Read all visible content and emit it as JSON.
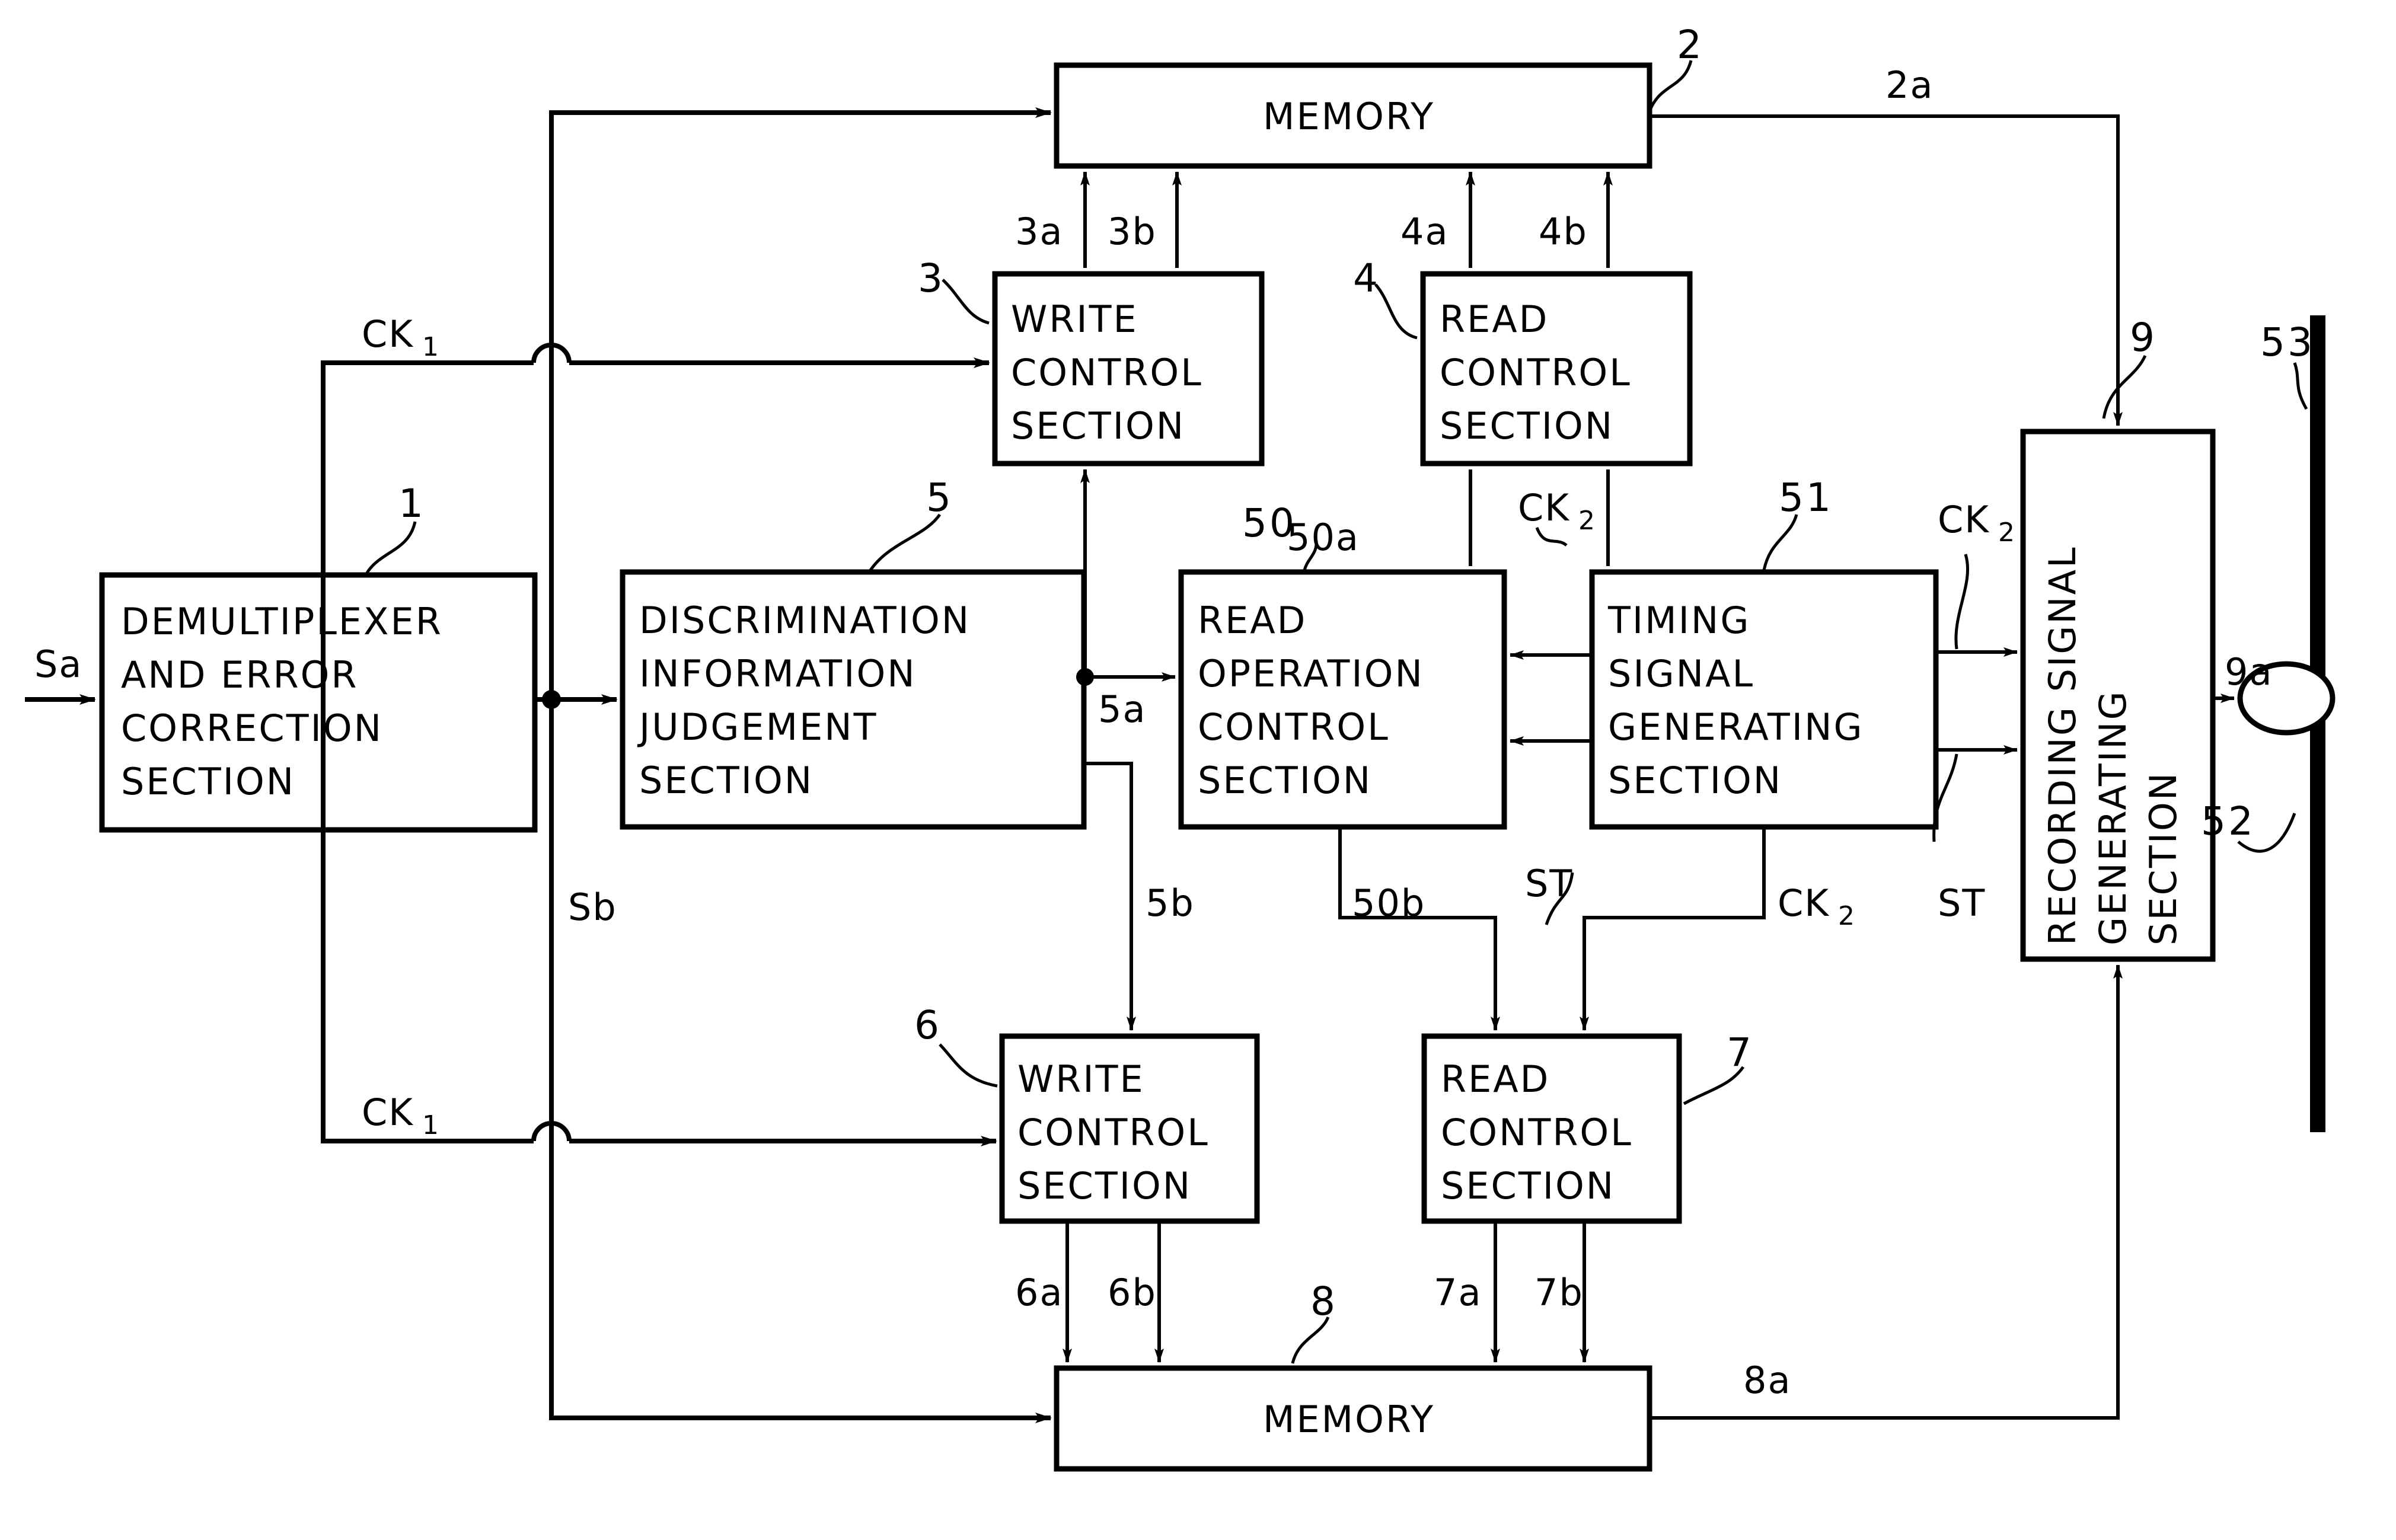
{
  "diagram": {
    "type": "block-diagram",
    "background": "#ffffff",
    "stroke": "#000000"
  },
  "blocks": {
    "demux": {
      "lines": [
        "DEMULTIPLEXER",
        "AND ERROR",
        "CORRECTION",
        "SECTION"
      ],
      "ref": "1"
    },
    "memory_top": {
      "lines": [
        "MEMORY"
      ],
      "ref": "2"
    },
    "write3": {
      "lines": [
        "WRITE",
        "CONTROL",
        "SECTION"
      ],
      "ref": "3"
    },
    "read4": {
      "lines": [
        "READ",
        "CONTROL",
        "SECTION"
      ],
      "ref": "4"
    },
    "discrim": {
      "lines": [
        "DISCRIMINATION",
        "INFORMATION",
        "JUDGEMENT",
        "SECTION"
      ],
      "ref": "5"
    },
    "readop": {
      "lines": [
        "READ",
        "OPERATION",
        "CONTROL",
        "SECTION"
      ],
      "ref": "50"
    },
    "timing": {
      "lines": [
        "TIMING",
        "SIGNAL",
        "GENERATING",
        "SECTION"
      ],
      "ref": "51"
    },
    "recording": {
      "lines": [
        "RECORDING SIGNAL",
        "GENERATING",
        "SECTION"
      ],
      "ref": "9"
    },
    "write6": {
      "lines": [
        "WRITE",
        "CONTROL",
        "SECTION"
      ],
      "ref": "6"
    },
    "read7": {
      "lines": [
        "READ",
        "CONTROL",
        "SECTION"
      ],
      "ref": "7"
    },
    "memory_bot": {
      "lines": [
        "MEMORY"
      ],
      "ref": "8"
    },
    "head": {
      "lines": [],
      "ref": "53"
    },
    "coil": {
      "lines": [],
      "ref": "52"
    }
  },
  "signals": {
    "sa": "Sa",
    "sb": "Sb",
    "ck1_upper": "CK",
    "ck1_upper_sub": "1",
    "ck1_lower": "CK",
    "ck1_lower_sub": "1",
    "ck2_a": "CK",
    "ck2_a_sub": "2",
    "ck2_b": "CK",
    "ck2_b_sub": "2",
    "ck2_c": "CK",
    "ck2_c_sub": "2",
    "st_a": "ST",
    "st_b": "ST",
    "bus_3a": "3a",
    "bus_3b": "3b",
    "bus_4a": "4a",
    "bus_4b": "4b",
    "bus_5a": "5a",
    "bus_5b": "5b",
    "bus_6a": "6a",
    "bus_6b": "6b",
    "bus_7a": "7a",
    "bus_7b": "7b",
    "bus_2a": "2a",
    "bus_8a": "8a",
    "bus_50a": "50a",
    "bus_50b": "50b",
    "bus_9a": "9a"
  },
  "refs": {
    "r1": "1",
    "r2": "2",
    "r3": "3",
    "r4": "4",
    "r5": "5",
    "r50": "50",
    "r51": "51",
    "r6": "6",
    "r7": "7",
    "r8": "8",
    "r9": "9",
    "r52": "52",
    "r53": "53"
  }
}
